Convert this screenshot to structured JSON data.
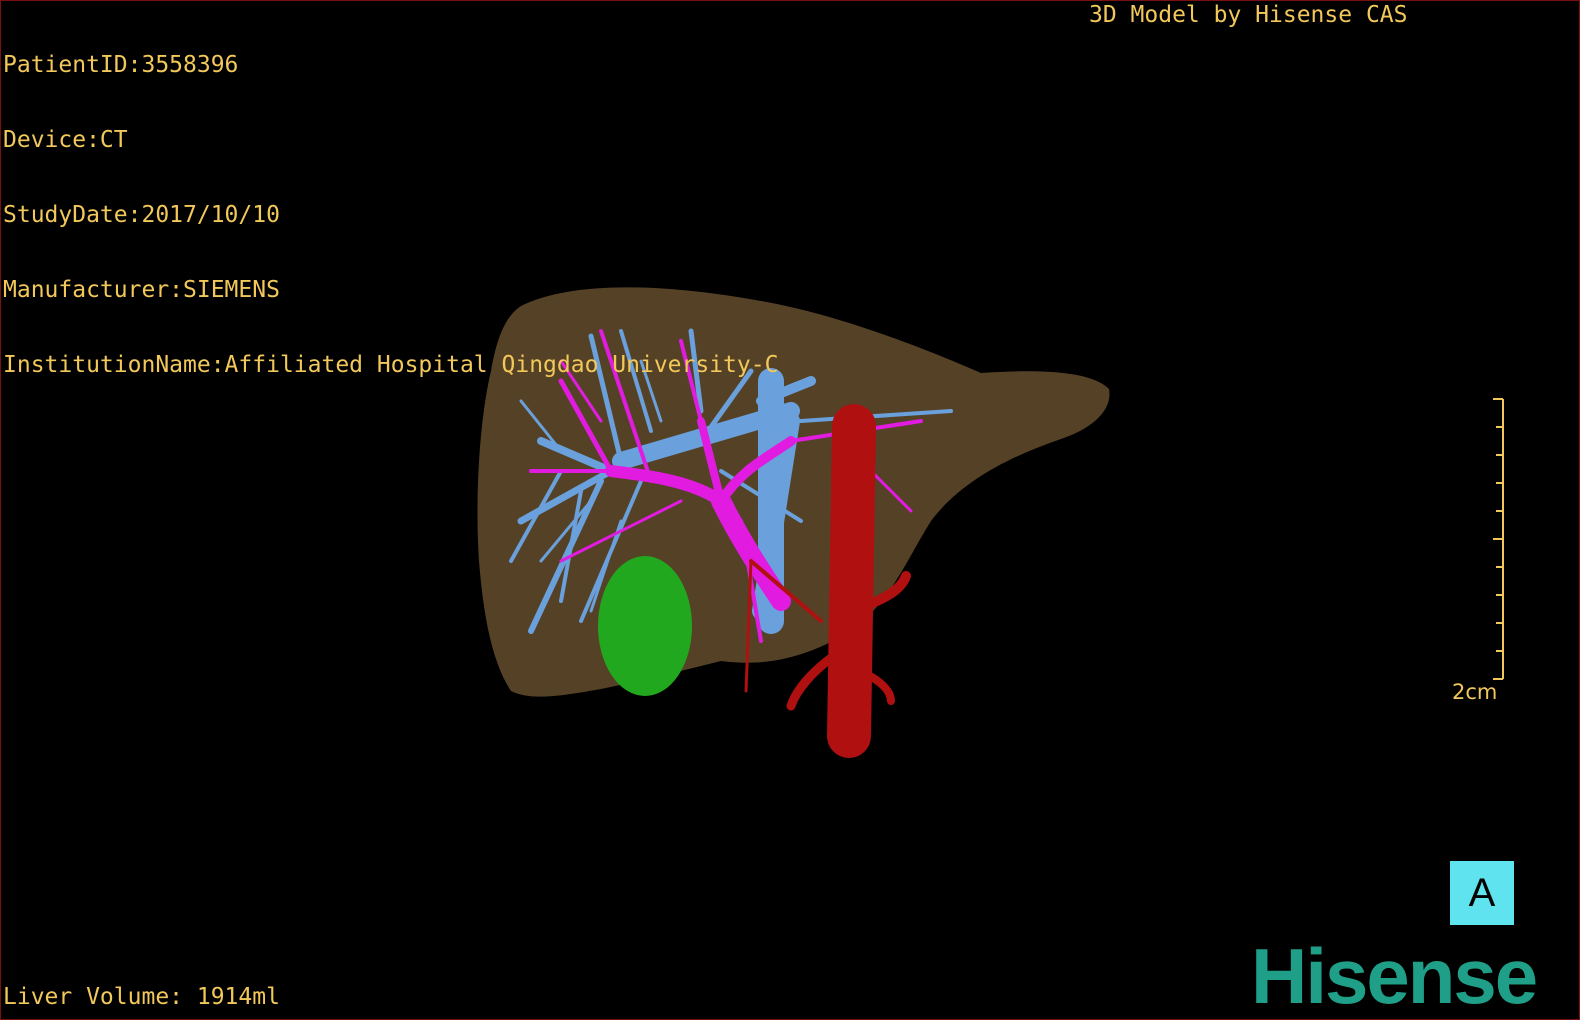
{
  "overlay": {
    "patient_id": "PatientID:3558396",
    "device": "Device:CT",
    "study_date": "StudyDate:2017/10/10",
    "manufacturer": "Manufacturer:SIEMENS",
    "institution": "InstitutionName:Affiliated Hospital Qingdao University-C",
    "credit": "3D Model by Hisense CAS",
    "liver_volume": "Liver Volume: 1914ml"
  },
  "scale_bar": {
    "label": "2cm"
  },
  "orientation": {
    "label": "A"
  },
  "brand": {
    "logo": "Hisense"
  },
  "colors": {
    "overlay_text": "#f2c85a",
    "liver": "#5a4628",
    "portal_vein": "#e21be0",
    "hepatic_vein": "#6aa0dc",
    "artery_ivc": "#b01010",
    "lesion": "#22a81e",
    "orientation_box": "#5fe3ef",
    "brand": "#1f9f87"
  }
}
